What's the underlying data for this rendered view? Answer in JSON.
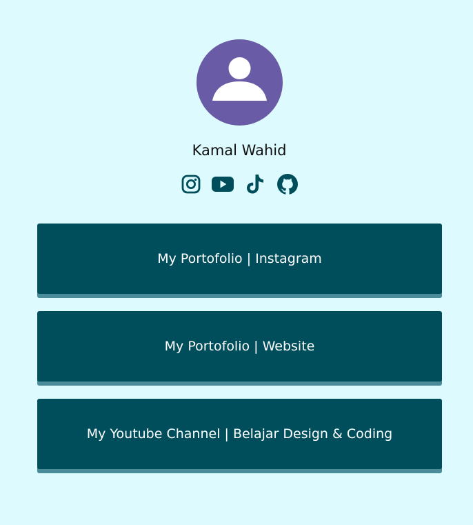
{
  "profile": {
    "name": "Kamal Wahid",
    "avatar_icon": "user-silhouette-icon",
    "avatar_color": "#6a5ba6"
  },
  "socials": [
    {
      "icon": "instagram-icon"
    },
    {
      "icon": "youtube-icon"
    },
    {
      "icon": "tiktok-icon"
    },
    {
      "icon": "github-icon"
    }
  ],
  "links": [
    {
      "label": "My Portofolio | Instagram"
    },
    {
      "label": "My Portofolio | Website"
    },
    {
      "label": "My Youtube Channel | Belajar Design & Coding"
    }
  ],
  "colors": {
    "background": "#ddfbff",
    "button": "#004d5c",
    "button_shadow": "#4a8c99",
    "icon": "#004d5c"
  }
}
